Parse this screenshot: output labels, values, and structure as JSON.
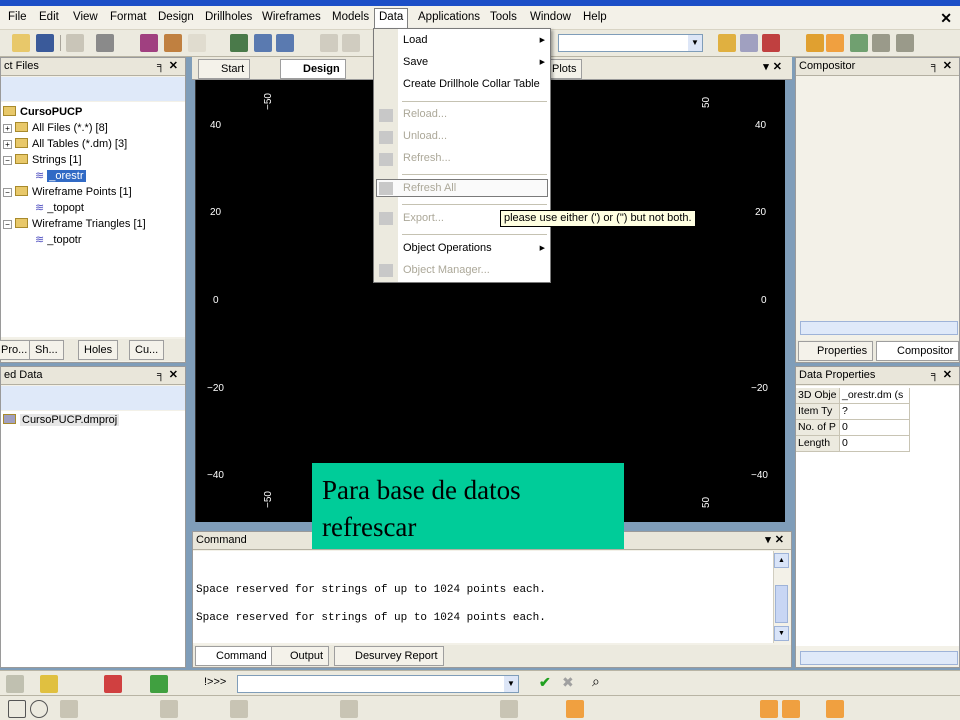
{
  "menubar": {
    "items": [
      "File",
      "Edit",
      "View",
      "Format",
      "Design",
      "Drillholes",
      "Wireframes",
      "Models",
      "Data",
      "Applications",
      "Tools",
      "Window",
      "Help"
    ],
    "active": "Data"
  },
  "left_panel_top": {
    "title": "ct Files",
    "project": "CursoPUCP",
    "items": [
      {
        "label": "All Files (*.*) [8]"
      },
      {
        "label": "All Tables (*.dm) [3]"
      },
      {
        "label": "Strings [1]"
      },
      {
        "label": "_orestr"
      },
      {
        "label": "Wireframe Points [1]"
      },
      {
        "label": "_topopt"
      },
      {
        "label": "Wireframe Triangles [1]"
      },
      {
        "label": "_topotr"
      }
    ],
    "tabs": [
      "Pro...",
      "Sh...",
      "Holes",
      "Cu..."
    ]
  },
  "left_panel_bottom": {
    "title": "ed Data",
    "file": "CursoPUCP.dmproj"
  },
  "center_tabs": {
    "start": "Start",
    "design": "Design",
    "plots": "Plots"
  },
  "viewport": {
    "y_ticks": [
      "40",
      "20",
      "0",
      "−20",
      "−40"
    ],
    "x_ticks_top": [
      "−50",
      "50"
    ],
    "x_ticks_bottom": [
      "−50",
      "50"
    ]
  },
  "data_menu": {
    "items": [
      {
        "label": "Load",
        "enabled": true,
        "submenu": true
      },
      {
        "label": "Save",
        "enabled": true,
        "submenu": true
      },
      {
        "label": "Create Drillhole Collar Table",
        "enabled": true,
        "submenu": false
      },
      {
        "label": "Reload...",
        "enabled": false
      },
      {
        "label": "Unload...",
        "enabled": false
      },
      {
        "label": "Refresh...",
        "enabled": false
      },
      {
        "label": "Refresh All",
        "enabled": false
      },
      {
        "label": "Export...",
        "enabled": false
      },
      {
        "label": "Object Operations",
        "enabled": true,
        "submenu": true
      },
      {
        "label": "Object Manager...",
        "enabled": false
      }
    ],
    "tooltip": "please use either (') or (\") but not both."
  },
  "overlay_note": {
    "line1": "Para base de datos",
    "line2": "refrescar"
  },
  "right_panel_top": {
    "title": "Compositor",
    "tabs": [
      "Properties",
      "Compositor"
    ]
  },
  "right_panel_bottom": {
    "title": "Data Properties",
    "rows": [
      {
        "key": "3D Obje",
        "value": "_orestr.dm (s"
      },
      {
        "key": "Item Ty",
        "value": "?"
      },
      {
        "key": "No. of P",
        "value": "0"
      },
      {
        "key": "Length",
        "value": "0"
      }
    ]
  },
  "command": {
    "title": "Command",
    "lines": [
      "Space reserved for strings of up to 1024 points each.",
      "Space reserved for strings of up to 1024 points each."
    ],
    "tabs": [
      "Command",
      "Output",
      "Desurvey Report"
    ],
    "prompt": "!>>>"
  },
  "colors": {
    "overlay": "#00cc99",
    "viewport": "#000000",
    "selection": "#316ac5"
  }
}
